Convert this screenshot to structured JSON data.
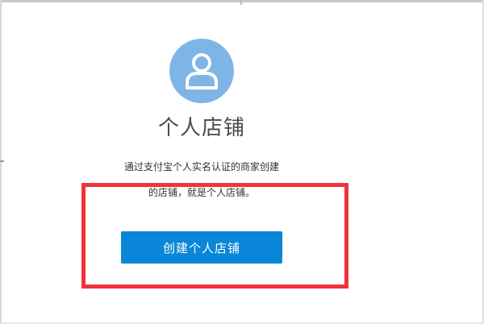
{
  "store": {
    "title": "个人店铺",
    "description_line1": "通过支付宝个人实名认证的商家创建",
    "description_line2": "的店铺，就是个人店铺。",
    "create_button_label": "创建个人店铺"
  },
  "icons": {
    "avatar": "user-icon"
  },
  "colors": {
    "avatar_bg": "#7fb4e6",
    "button_bg": "#0a86d8",
    "highlight": "#f0343a"
  }
}
